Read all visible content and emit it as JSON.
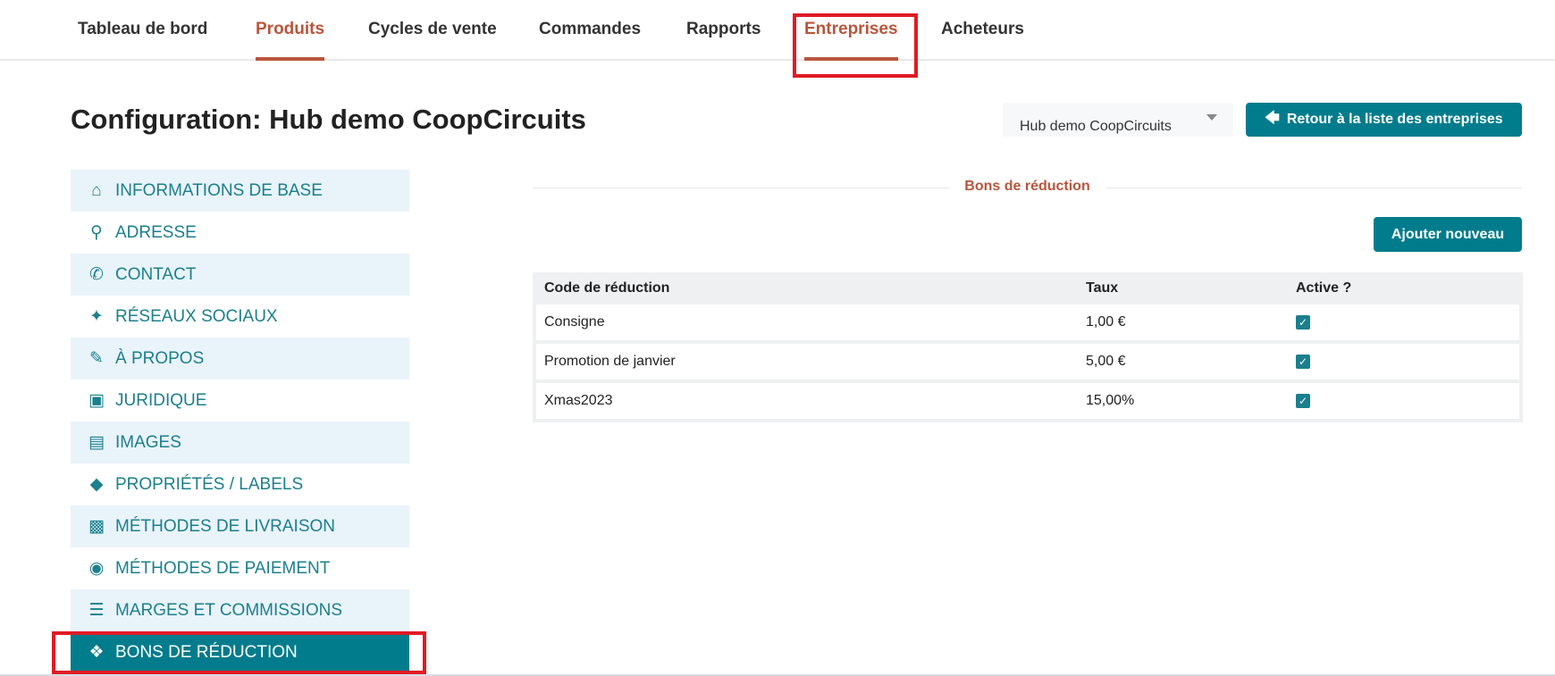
{
  "nav": {
    "tabs": [
      {
        "label": "Tableau de bord"
      },
      {
        "label": "Produits"
      },
      {
        "label": "Cycles de vente"
      },
      {
        "label": "Commandes"
      },
      {
        "label": "Rapports"
      },
      {
        "label": "Entreprises"
      },
      {
        "label": "Acheteurs"
      }
    ]
  },
  "header": {
    "title": "Configuration: Hub demo CoopCircuits",
    "enterprise_select": "Hub demo CoopCircuits",
    "back_button": "Retour à la liste des entreprises"
  },
  "sidebar": {
    "items": [
      {
        "label": "INFORMATIONS DE BASE",
        "icon": "home-icon"
      },
      {
        "label": "ADRESSE",
        "icon": "map-marker-icon"
      },
      {
        "label": "CONTACT",
        "icon": "phone-icon"
      },
      {
        "label": "RÉSEAUX SOCIAUX",
        "icon": "twitter-icon"
      },
      {
        "label": "À PROPOS",
        "icon": "pencil-icon"
      },
      {
        "label": "JURIDIQUE",
        "icon": "briefcase-icon"
      },
      {
        "label": "IMAGES",
        "icon": "image-icon"
      },
      {
        "label": "PROPRIÉTÉS / LABELS",
        "icon": "tags-icon"
      },
      {
        "label": "MÉTHODES DE LIVRAISON",
        "icon": "truck-icon"
      },
      {
        "label": "MÉTHODES DE PAIEMENT",
        "icon": "money-icon"
      },
      {
        "label": "MARGES ET COMMISSIONS",
        "icon": "server-icon"
      },
      {
        "label": "BONS DE RÉDUCTION",
        "icon": "ticket-icon"
      }
    ]
  },
  "main": {
    "section_title": "Bons de réduction",
    "add_button": "Ajouter nouveau",
    "table": {
      "headers": [
        "Code de réduction",
        "Taux",
        "Active ?"
      ],
      "rows": [
        {
          "code": "Consigne",
          "rate": "1,00 €",
          "active": true
        },
        {
          "code": "Promotion de janvier",
          "rate": "5,00 €",
          "active": true
        },
        {
          "code": "Xmas2023",
          "rate": "15,00%",
          "active": true
        }
      ]
    }
  },
  "colors": {
    "accent": "#007c8c",
    "active_tab": "#b9553b",
    "highlight": "#e01b24"
  }
}
